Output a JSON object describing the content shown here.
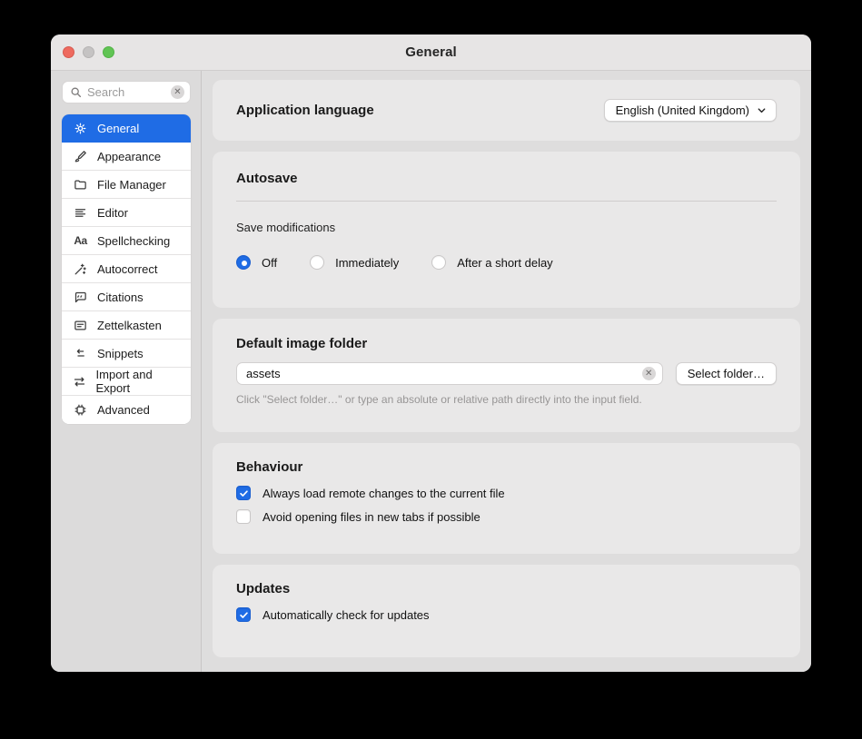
{
  "window": {
    "title": "General"
  },
  "colors": {
    "accent": "#1f6ce5",
    "card_bg": "#e9e8e8",
    "sidebar_bg": "#dcdbdb"
  },
  "sidebar": {
    "search": {
      "placeholder": "Search"
    },
    "items": [
      {
        "label": "General",
        "icon": "gear-icon",
        "selected": true
      },
      {
        "label": "Appearance",
        "icon": "paintbrush-icon",
        "selected": false
      },
      {
        "label": "File Manager",
        "icon": "folder-icon",
        "selected": false
      },
      {
        "label": "Editor",
        "icon": "text-lines-icon",
        "selected": false
      },
      {
        "label": "Spellchecking",
        "icon": "aa-letters-icon",
        "selected": false
      },
      {
        "label": "Autocorrect",
        "icon": "magic-wand-icon",
        "selected": false
      },
      {
        "label": "Citations",
        "icon": "quote-bubble-icon",
        "selected": false
      },
      {
        "label": "Zettelkasten",
        "icon": "note-card-icon",
        "selected": false
      },
      {
        "label": "Snippets",
        "icon": "indent-arrow-icon",
        "selected": false
      },
      {
        "label": "Import and Export",
        "icon": "swap-arrows-icon",
        "selected": false
      },
      {
        "label": "Advanced",
        "icon": "cpu-chip-icon",
        "selected": false
      }
    ]
  },
  "main": {
    "language": {
      "label": "Application language",
      "value": "English (United Kingdom)"
    },
    "autosave": {
      "title": "Autosave",
      "field_label": "Save modifications",
      "options": [
        {
          "label": "Off",
          "selected": true
        },
        {
          "label": "Immediately",
          "selected": false
        },
        {
          "label": "After a short delay",
          "selected": false
        }
      ]
    },
    "image_folder": {
      "title": "Default image folder",
      "input_value": "assets",
      "button_label": "Select folder…",
      "hint": "Click \"Select folder…\" or type an absolute or relative path directly into the input field."
    },
    "behaviour": {
      "title": "Behaviour",
      "checkboxes": [
        {
          "label": "Always load remote changes to the current file",
          "checked": true
        },
        {
          "label": "Avoid opening files in new tabs if possible",
          "checked": false
        }
      ]
    },
    "updates": {
      "title": "Updates",
      "checkboxes": [
        {
          "label": "Automatically check for updates",
          "checked": true
        }
      ]
    }
  }
}
